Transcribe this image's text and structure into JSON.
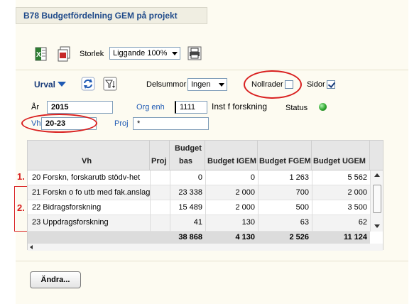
{
  "title": "B78 Budgetfördelning GEM på projekt",
  "toolbar": {
    "storlek_label": "Storlek",
    "storlek_value": "Liggande 100%"
  },
  "urval": {
    "label": "Urval",
    "delsummor_label": "Delsummor",
    "delsummor_value": "Ingen",
    "nollrader_label": "Nollrader",
    "nollrader_checked": false,
    "sidor_label": "Sidor",
    "sidor_checked": true
  },
  "filters": {
    "ar_label": "År",
    "ar_value": "2015",
    "orgenh_label": "Org enh",
    "orgenh_value": "1111",
    "orgenh_name": "Inst f forskning",
    "status_label": "Status",
    "status_color": "#2fa82f",
    "vh_label": "Vh",
    "vh_value": "20-23",
    "proj_label": "Proj",
    "proj_value": "*"
  },
  "annotations": {
    "one": "1.",
    "two": "2."
  },
  "table": {
    "headers": {
      "vh": "Vh",
      "proj": "Proj",
      "budget_bas_line1": "Budget",
      "budget_bas_line2": "bas",
      "budget_igem": "Budget IGEM",
      "budget_fgem": "Budget FGEM",
      "budget_ugem": "Budget UGEM"
    },
    "rows": [
      {
        "vh": "20 Forskn, forskarutb stödv-het",
        "proj": "",
        "bas": "0",
        "igem": "0",
        "fgem": "1 263",
        "ugem": "5 562"
      },
      {
        "vh": "21 Forskn o fo utb med fak.anslag",
        "proj": "",
        "bas": "23 338",
        "igem": "2 000",
        "fgem": "700",
        "ugem": "2 000"
      },
      {
        "vh": "22 Bidragsforskning",
        "proj": "",
        "bas": "15 489",
        "igem": "2 000",
        "fgem": "500",
        "ugem": "3 500"
      },
      {
        "vh": "23 Uppdragsforskning",
        "proj": "",
        "bas": "41",
        "igem": "130",
        "fgem": "63",
        "ugem": "62"
      }
    ],
    "totals": {
      "bas": "38 868",
      "igem": "4 130",
      "fgem": "2 526",
      "ugem": "11 124"
    }
  },
  "buttons": {
    "andra": "Ändra..."
  }
}
